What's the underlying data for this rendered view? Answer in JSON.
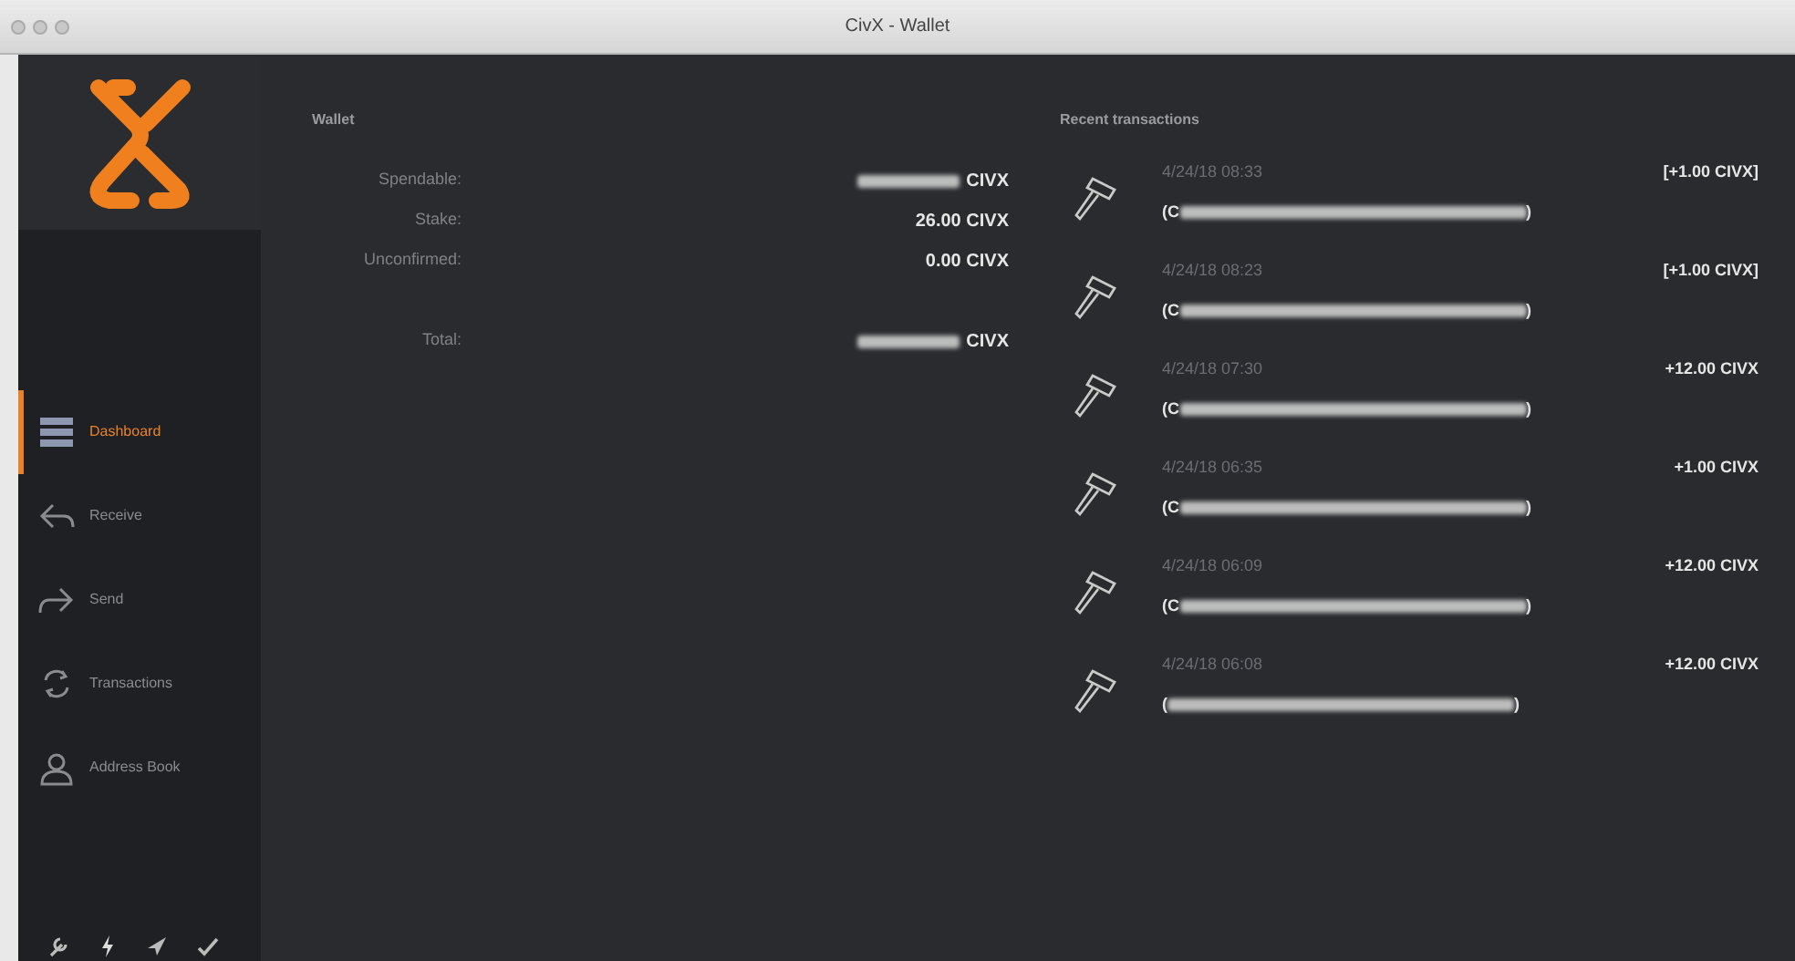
{
  "window": {
    "title": "CivX - Wallet"
  },
  "sidebar": {
    "items": [
      {
        "label": "Dashboard",
        "kind": "dashboard",
        "selected": true
      },
      {
        "label": "Receive",
        "kind": "receive",
        "selected": false
      },
      {
        "label": "Send",
        "kind": "send",
        "selected": false
      },
      {
        "label": "Transactions",
        "kind": "transactions",
        "selected": false
      },
      {
        "label": "Address Book",
        "kind": "address",
        "selected": false
      }
    ]
  },
  "wallet": {
    "title": "Wallet",
    "rows": [
      {
        "label": "Spendable:",
        "value": "CIVX",
        "redacted": true
      },
      {
        "label": "Stake:",
        "value": "26.00 CIVX",
        "redacted": false
      },
      {
        "label": "Unconfirmed:",
        "value": "0.00 CIVX",
        "redacted": false
      },
      {
        "label": "Total:",
        "value": "CIVX",
        "redacted": true
      }
    ]
  },
  "recent": {
    "title": "Recent transactions",
    "items": [
      {
        "date": "4/24/18 08:33",
        "address_start": "(C",
        "address_end": ")",
        "amount": "[+1.00 CIVX]"
      },
      {
        "date": "4/24/18 08:23",
        "address_start": "(C",
        "address_end": ")",
        "amount": "[+1.00 CIVX]"
      },
      {
        "date": "4/24/18 07:30",
        "address_start": "(C",
        "address_end": ")",
        "amount": "+12.00 CIVX"
      },
      {
        "date": "4/24/18 06:35",
        "address_start": "(C",
        "address_end": ")",
        "amount": "+1.00 CIVX"
      },
      {
        "date": "4/24/18 06:09",
        "address_start": "(C",
        "address_end": ")",
        "amount": "+12.00 CIVX"
      },
      {
        "date": "4/24/18 06:08",
        "address_start": "(",
        "address_end": ")",
        "amount": "+12.00 CIVX"
      }
    ]
  }
}
